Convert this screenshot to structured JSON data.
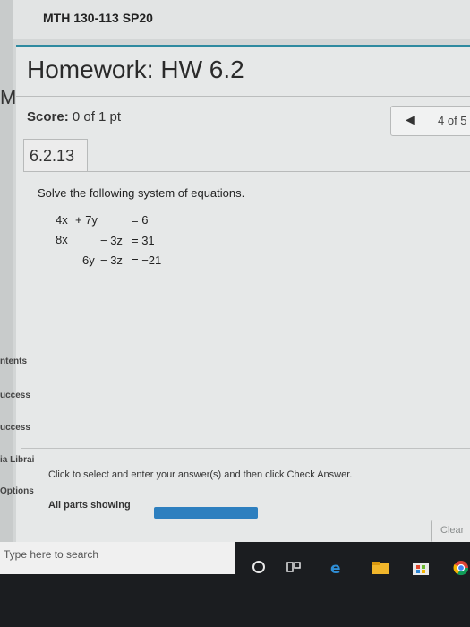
{
  "course": {
    "title": "MTH 130-113 SP20"
  },
  "sidebar": {
    "letter": "M"
  },
  "homework": {
    "title": "Homework: HW 6.2"
  },
  "score": {
    "label": "Score:",
    "value": "0 of 1 pt"
  },
  "nav": {
    "position": "4 of 5"
  },
  "question": {
    "number": "6.2.13",
    "prompt": "Solve the following system of equations.",
    "equations": [
      {
        "a": "4x",
        "b": "+ 7y",
        "c": "",
        "eq": "= 6"
      },
      {
        "a": "8x",
        "b": "",
        "c": "− 3z",
        "eq": "= 31"
      },
      {
        "a": "",
        "b": "6y",
        "c": "− 3z",
        "eq": "= −21"
      }
    ]
  },
  "left_nav": {
    "items": [
      "ntents",
      "uccess",
      "uccess",
      "ia Librai",
      "Options"
    ]
  },
  "footer": {
    "instruction": "Click to select and enter your answer(s) and then click Check Answer.",
    "parts": "All parts showing",
    "progress_fraction": 1.0,
    "clear_label": "Clear"
  },
  "taskbar": {
    "search_placeholder": "Type here to search",
    "icons": [
      "cortana-icon",
      "task-view-icon",
      "edge-icon",
      "file-explorer-icon",
      "store-icon",
      "chrome-icon"
    ]
  },
  "colors": {
    "accent": "#2e8aa0",
    "progress": "#2d7fbf"
  }
}
